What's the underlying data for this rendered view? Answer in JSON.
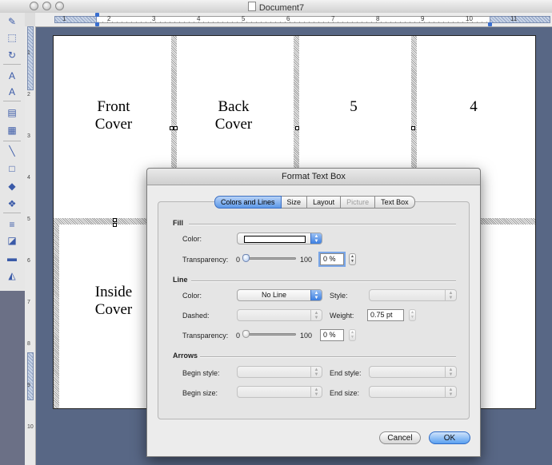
{
  "window": {
    "title": "Document7"
  },
  "ruler": {
    "numbers": [
      "1",
      "2",
      "3",
      "4",
      "5",
      "6",
      "7",
      "8",
      "9",
      "10",
      "11"
    ],
    "vertical_numbers": [
      "1",
      "2",
      "3",
      "4",
      "5",
      "6",
      "7",
      "8",
      "9",
      "10"
    ]
  },
  "toolbox": {
    "tools": [
      {
        "name": "style-icon",
        "glyph": "✎"
      },
      {
        "name": "select-icon",
        "glyph": "⬚"
      },
      {
        "name": "rotate-icon",
        "glyph": "↻"
      },
      {
        "name": "text-box-icon",
        "glyph": "A"
      },
      {
        "name": "wordart-icon",
        "glyph": "A"
      },
      {
        "name": "picture-icon",
        "glyph": "▤"
      },
      {
        "name": "clip-art-icon",
        "glyph": "▦"
      },
      {
        "name": "line-icon",
        "glyph": "╲"
      },
      {
        "name": "rectangle-icon",
        "glyph": "□"
      },
      {
        "name": "autoshape-icon",
        "glyph": "◆"
      },
      {
        "name": "grouped-shapes-icon",
        "glyph": "❖"
      },
      {
        "name": "line-style-icon",
        "glyph": "≡"
      },
      {
        "name": "fill-color-icon",
        "glyph": "◪"
      },
      {
        "name": "line-color-icon",
        "glyph": "▬"
      },
      {
        "name": "font-color-icon",
        "glyph": "◭"
      }
    ]
  },
  "document": {
    "panels": [
      {
        "id": "front-cover",
        "line1": "Front",
        "line2": "Cover"
      },
      {
        "id": "back-cover",
        "line1": "Back",
        "line2": "Cover"
      },
      {
        "id": "page-5",
        "line1": "5",
        "line2": ""
      },
      {
        "id": "page-4",
        "line1": "4",
        "line2": ""
      },
      {
        "id": "inside-cover",
        "line1": "Inside",
        "line2": "Cover"
      }
    ]
  },
  "dialog": {
    "title": "Format Text Box",
    "tabs": [
      {
        "label": "Colors and Lines",
        "state": "active"
      },
      {
        "label": "Size",
        "state": "normal"
      },
      {
        "label": "Layout",
        "state": "normal"
      },
      {
        "label": "Picture",
        "state": "disabled"
      },
      {
        "label": "Text Box",
        "state": "normal"
      }
    ],
    "fill": {
      "heading": "Fill",
      "color_label": "Color:",
      "color_value": "#ffffff",
      "transparency_label": "Transparency:",
      "slider_min": "0",
      "slider_max": "100",
      "transparency_value": "0 %",
      "transparency_fraction": 0.0
    },
    "line": {
      "heading": "Line",
      "color_label": "Color:",
      "color_value": "No Line",
      "style_label": "Style:",
      "dashed_label": "Dashed:",
      "weight_label": "Weight:",
      "weight_value": "0.75 pt",
      "transparency_label": "Transparency:",
      "slider_min": "0",
      "slider_max": "100",
      "transparency_value": "0 %",
      "transparency_fraction": 0.0
    },
    "arrows": {
      "heading": "Arrows",
      "begin_style_label": "Begin style:",
      "end_style_label": "End style:",
      "begin_size_label": "Begin size:",
      "end_size_label": "End size:"
    },
    "buttons": {
      "cancel": "Cancel",
      "ok": "OK"
    }
  },
  "colors": {
    "workspace": "#586785",
    "accent": "#5a9cf0"
  }
}
